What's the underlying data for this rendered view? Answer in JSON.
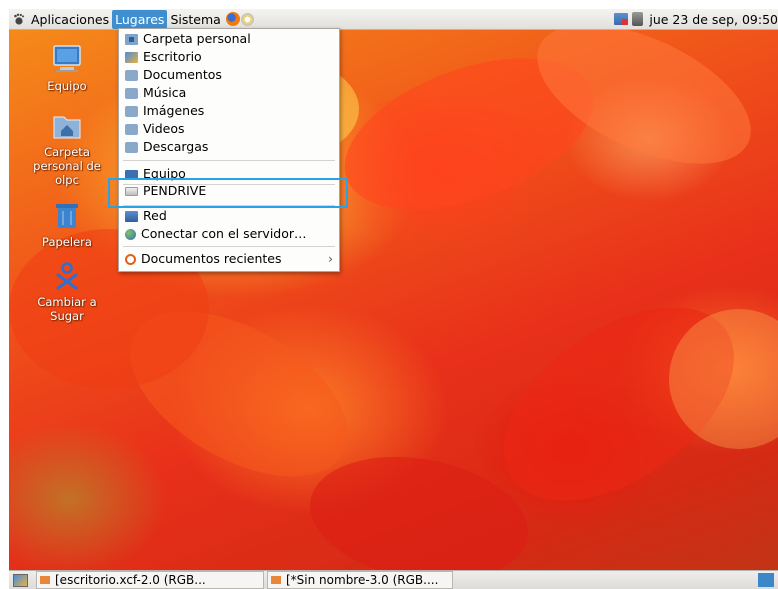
{
  "top_panel": {
    "menus": [
      "Aplicaciones",
      "Lugares",
      "Sistema"
    ],
    "active_menu": "Lugares",
    "clock": "jue 23 de sep, 09:50"
  },
  "desktop_icons": [
    {
      "label": "Equipo"
    },
    {
      "label": "Carpeta personal de olpc"
    },
    {
      "label": "Papelera"
    },
    {
      "label": "Cambiar a Sugar"
    }
  ],
  "places_menu": {
    "items": [
      {
        "label": "Carpeta personal",
        "icon": "home-folder-icon"
      },
      {
        "label": "Escritorio",
        "icon": "desktop-icon"
      },
      {
        "label": "Documentos",
        "icon": "folder-icon"
      },
      {
        "label": "Música",
        "icon": "folder-icon"
      },
      {
        "label": "Imágenes",
        "icon": "folder-icon"
      },
      {
        "label": "Videos",
        "icon": "folder-icon"
      },
      {
        "label": "Descargas",
        "icon": "folder-icon"
      },
      {
        "label": "Equipo",
        "icon": "computer-icon"
      },
      {
        "label": "PENDRIVE",
        "icon": "usb-drive-icon"
      },
      {
        "label": "Red",
        "icon": "network-icon"
      },
      {
        "label": "Conectar con el servidor…",
        "icon": "globe-icon"
      },
      {
        "label": "Documentos recientes",
        "icon": "recent-icon",
        "submenu_arrow": "›"
      }
    ],
    "highlighted_item": "PENDRIVE"
  },
  "bottom_panel": {
    "tasks": [
      {
        "label": "[escritorio.xcf-2.0 (RGB..."
      },
      {
        "label": "[*Sin nombre-3.0 (RGB...."
      }
    ]
  },
  "colors": {
    "menu_active": "#3f8fd0",
    "highlight_box": "#2aa3e6",
    "folder": "#8aa8c8"
  }
}
